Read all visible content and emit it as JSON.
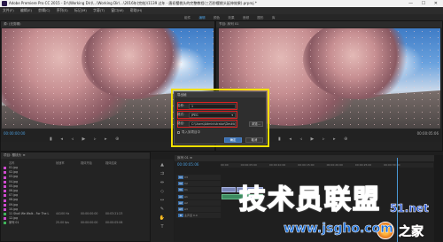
{
  "window": {
    "title": "Adobe Premiere Pro CC 2015 - D:\\(Working Dir)\\...\\Working Dir\\...\\2016年(完结)\\1139 过年 · 唐初樱桃头的完整教程(三百秒樱桃头延伸效果).prproj *",
    "controls": "— ☐ ✕"
  },
  "menu": [
    "文件(F)",
    "编辑(E)",
    "剪辑(C)",
    "序列(S)",
    "标记(M)",
    "字幕(T)",
    "窗口(W)",
    "帮助(H)"
  ],
  "workspace_tabs": [
    {
      "label": "组件",
      "active": false
    },
    {
      "label": "编辑",
      "active": true
    },
    {
      "label": "颜色",
      "active": false
    },
    {
      "label": "效果",
      "active": false
    },
    {
      "label": "音频",
      "active": false
    },
    {
      "label": "图形",
      "active": false
    },
    {
      "label": "库",
      "active": false
    }
  ],
  "source_monitor": {
    "header": "源: (无剪辑)",
    "timecode_left": "00:00:00:00",
    "timecode_right": "00:00:05:06"
  },
  "program_monitor": {
    "header": "节目: 序列 01",
    "timecode_left": "00:00:00:00",
    "timecode_right": "00:00:05:06"
  },
  "dialog": {
    "title": "导出帧",
    "name_label": "名称:",
    "name_value": "1",
    "format_label": "格式:",
    "format_value": "JPEG",
    "path_label": "路径:",
    "path_value": "C:\\Users\\Administrator\\Desktop",
    "browse_label": "浏览...",
    "import_checkbox_label": "导入到项目中",
    "ok_label": "确定",
    "cancel_label": "取消"
  },
  "project_panel": {
    "header": "项目: 樱桃头  ≡",
    "columns": [
      "名称",
      "帧速率",
      "媒体开始",
      "媒体结束"
    ],
    "items": [
      {
        "name": "01.jpg",
        "c2": "",
        "c3": "",
        "c4": ""
      },
      {
        "name": "02.jpg",
        "c2": "",
        "c3": "",
        "c4": ""
      },
      {
        "name": "03.jpg",
        "c2": "",
        "c3": "",
        "c4": ""
      },
      {
        "name": "04.jpg",
        "c2": "",
        "c3": "",
        "c4": ""
      },
      {
        "name": "05.jpg",
        "c2": "",
        "c3": "",
        "c4": ""
      },
      {
        "name": "06.jpg",
        "c2": "",
        "c3": "",
        "c4": ""
      },
      {
        "name": "07.jpg",
        "c2": "",
        "c3": "",
        "c4": ""
      },
      {
        "name": "08.jpg",
        "c2": "",
        "c3": "",
        "c4": ""
      },
      {
        "name": "09.jpg",
        "c2": "",
        "c3": "",
        "c4": ""
      },
      {
        "name": "10.jpg",
        "c2": "",
        "c3": "",
        "c4": ""
      },
      {
        "name": "11 Shall We Walk - For The L",
        "c2": "44100 Hz",
        "c3": "00:00:00:00",
        "c4": "00:03:21:23"
      },
      {
        "name": "12.jpg",
        "c2": "",
        "c3": "",
        "c4": ""
      },
      {
        "name": "序列 01",
        "c2": "25.00 fps",
        "c3": "00:00:00:00",
        "c4": "00:00:05:06"
      }
    ]
  },
  "timeline": {
    "header": "序列 01  ≡",
    "timecode": "00:00:05:06",
    "ruler": [
      "00:00",
      "00:00:05:00",
      "00:00:10:00",
      "00:00:15:00",
      "00:00:20:00",
      "00:00:25:00",
      "00:00:30:00"
    ],
    "tracks": [
      {
        "badge": "V3",
        "label": "V3"
      },
      {
        "badge": "V2",
        "label": "V2"
      },
      {
        "badge": "V1",
        "label": "V1"
      },
      {
        "badge": "A1",
        "label": "A1"
      },
      {
        "badge": "A2",
        "label": "A2"
      },
      {
        "badge": "A3",
        "label": "A3"
      },
      {
        "badge": "M",
        "label": "主声道 0.0"
      }
    ]
  },
  "watermark": {
    "brand_cn": "技术员联盟",
    "brand_num": "51.net",
    "url": "www.jsgho.com",
    "home_cn": "之家"
  }
}
